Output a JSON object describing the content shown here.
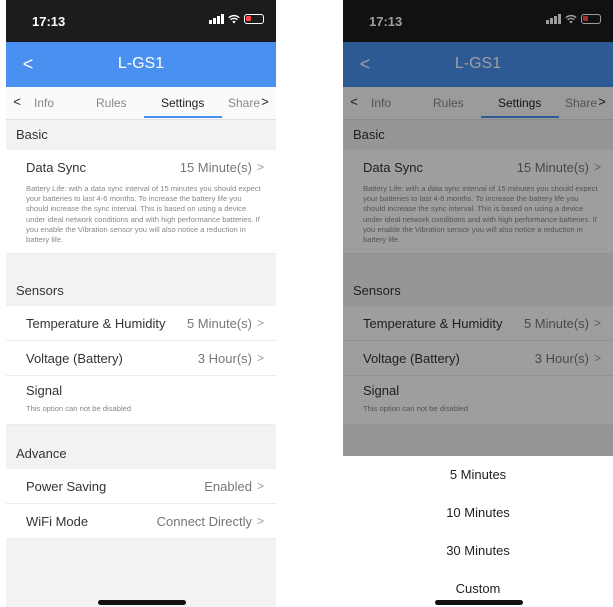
{
  "status": {
    "time": "17:13"
  },
  "nav": {
    "title": "L-GS1",
    "back": "<"
  },
  "tabs": {
    "left_arrow": "<",
    "right_arrow": ">",
    "info": "Info",
    "rules": "Rules",
    "settings": "Settings",
    "share": "Share"
  },
  "basic": {
    "header": "Basic",
    "data_sync": {
      "label": "Data Sync",
      "value": "15 Minute(s)",
      "description": "Battery Life: with a data sync interval of 15 minutes you should expect your batteries to last 4-6 months. To increase the battery life you should increase the sync interval. This is based on using a device under ideal network conditions and with high performance batteries. If you enable the Vibration sensor you will also notice a reduction in battery life."
    }
  },
  "sensors": {
    "header": "Sensors",
    "temp": {
      "label": "Temperature & Humidity",
      "value": "5 Minute(s)"
    },
    "voltage": {
      "label": "Voltage (Battery)",
      "value": "3 Hour(s)"
    },
    "signal": {
      "label": "Signal",
      "note": "This option can not be disabled"
    }
  },
  "advance": {
    "header": "Advance",
    "power": {
      "label": "Power Saving",
      "value": "Enabled"
    },
    "wifi": {
      "label": "WiFi Mode",
      "value": "Connect Directly"
    }
  },
  "picker": {
    "options": [
      "5 Minutes",
      "10 Minutes",
      "30 Minutes",
      "Custom"
    ]
  },
  "chevron": ">"
}
